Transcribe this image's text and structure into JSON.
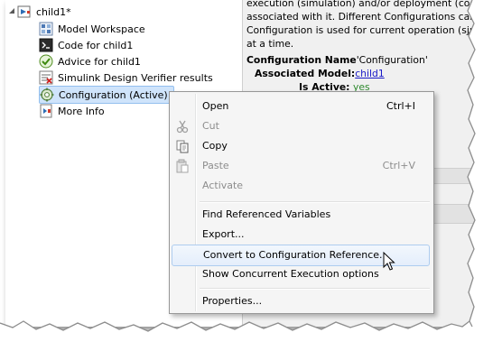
{
  "tree": {
    "root_label": "child1*",
    "items": [
      {
        "label": "Model Workspace",
        "icon": "model-workspace-icon"
      },
      {
        "label": "Code for child1",
        "icon": "code-icon"
      },
      {
        "label": "Advice for child1",
        "icon": "advice-check-icon"
      },
      {
        "label": "Simulink Design Verifier results",
        "icon": "verifier-results-icon"
      },
      {
        "label": "Configuration (Active)",
        "icon": "configuration-gear-icon"
      },
      {
        "label": "More Info",
        "icon": "more-info-icon"
      }
    ]
  },
  "info": {
    "lines": [
      "execution (simulation) and/or deployment (code gene",
      "associated with it. Different Configurations can be d",
      "Configuration is used for current operation (simulatio",
      "at a time."
    ],
    "name_label": "Configuration Name",
    "name_value": "'Configuration'",
    "model_label": "Associated Model:",
    "model_value": "child1",
    "active_label": "Is Active:",
    "active_value": "yes"
  },
  "menu": {
    "open": {
      "label": "Open",
      "shortcut": "Ctrl+I"
    },
    "cut": {
      "label": "Cut"
    },
    "copy": {
      "label": "Copy"
    },
    "paste": {
      "label": "Paste",
      "shortcut": "Ctrl+V"
    },
    "activate": {
      "label": "Activate"
    },
    "find_refs": {
      "label": "Find Referenced Variables"
    },
    "export": {
      "label": "Export..."
    },
    "convert": {
      "label": "Convert to Configuration Reference..."
    },
    "concurrent": {
      "label": "Show Concurrent Execution options"
    },
    "properties": {
      "label": "Properties..."
    }
  },
  "colors": {
    "selection": "#cfe4fb",
    "menu_hover": "#e4eefb",
    "link": "#1a1ac8",
    "active_green": "#2e8a2e"
  }
}
